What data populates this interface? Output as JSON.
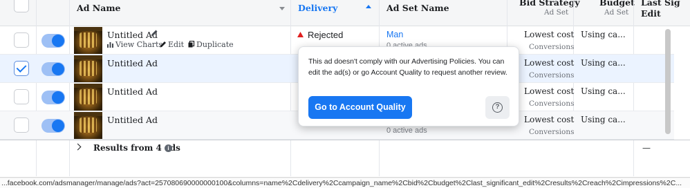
{
  "header": {
    "ad_name": "Ad Name",
    "delivery": "Delivery",
    "ad_set_name": "Ad Set Name",
    "bid_strategy": "Bid Strategy",
    "bid_strategy_sub": "Ad Set",
    "budget": "Budget",
    "budget_sub": "Ad Set",
    "last_sig": "Last Sig",
    "last_sig_sub": "Edit"
  },
  "rows": [
    {
      "name": "Untitled Ad",
      "delivery": "Rejected",
      "ad_set": "Man",
      "ad_set_sub": "0 active ads",
      "bid": "Lowest cost",
      "bid_sub": "Conversions",
      "budget": "Using ca...",
      "checked": false
    },
    {
      "name": "Untitled Ad",
      "bid": "Lowest cost",
      "bid_sub": "Conversions",
      "budget": "Using ca...",
      "checked": true
    },
    {
      "name": "Untitled Ad",
      "bid": "Lowest cost",
      "bid_sub": "Conversions",
      "budget": "Using ca...",
      "checked": false
    },
    {
      "name": "Untitled Ad",
      "ad_set_sub": "0 active ads",
      "bid": "Lowest cost",
      "bid_sub": "Conversions",
      "budget": "Using ca...",
      "checked": false
    }
  ],
  "row_actions": {
    "view_charts": "View Charts",
    "edit": "Edit",
    "duplicate": "Duplicate"
  },
  "summary": {
    "label": "Results from 4 ads",
    "last_sig": "—"
  },
  "popover": {
    "message": "This ad doesn't comply with our Advertising Policies. You can edit the ad(s) or go Account Quality to request another review.",
    "button": "Go to Account Quality",
    "help": "?"
  },
  "status_url": "...facebook.com/adsmanager/manage/ads?act=257080690000000100&columns=name%2Cdelivery%2Ccampaign_name%2Cbid%2Cbudget%2Clast_significant_edit%2Cresults%2Creach%2Cimpressions%2C...",
  "colors": {
    "accent": "#1877f2",
    "rejected": "#e02020"
  }
}
